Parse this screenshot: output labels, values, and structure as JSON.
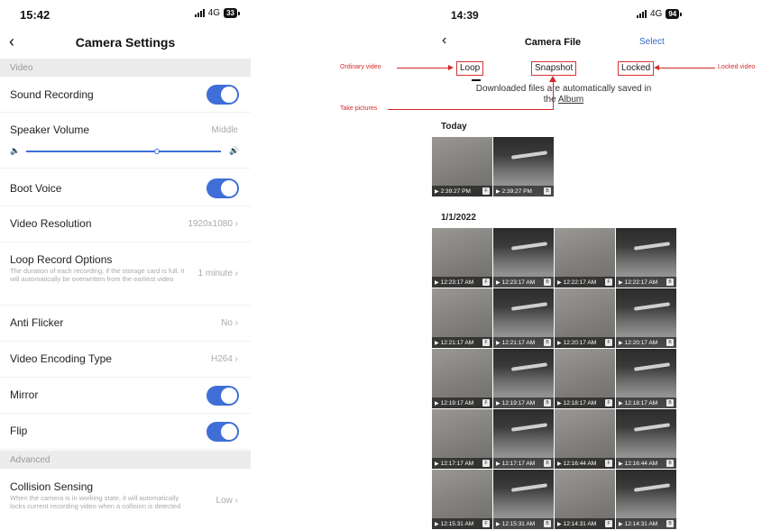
{
  "settings": {
    "status": {
      "time": "15:42",
      "network": "4G",
      "battery": "33"
    },
    "title": "Camera Settings",
    "sections": {
      "video": "Video",
      "advanced": "Advanced"
    },
    "sound_recording": {
      "label": "Sound Recording",
      "on": true
    },
    "speaker_volume": {
      "label": "Speaker Volume",
      "value": "Middle",
      "level_percent": 67
    },
    "boot_voice": {
      "label": "Boot Voice",
      "on": true
    },
    "video_resolution": {
      "label": "Video Resolution",
      "value": "1920x1080 ›"
    },
    "loop_record": {
      "label": "Loop Record Options",
      "desc": "The duration of each recording, if the storage card is full, it will automatically be overwritten from the earliest video",
      "value": "1 minute ›"
    },
    "anti_flicker": {
      "label": "Anti Flicker",
      "value": "No ›"
    },
    "encoding": {
      "label": "Video Encoding Type",
      "value": "H264 ›"
    },
    "mirror": {
      "label": "Mirror",
      "on": true
    },
    "flip": {
      "label": "Flip",
      "on": true
    },
    "collision": {
      "label": "Collision Sensing",
      "desc": "When the camera is in working state, it will automatically locks current recording video when a collision is detected",
      "value": "Low ›"
    }
  },
  "files": {
    "status": {
      "time": "14:39",
      "network": "4G",
      "battery": "94"
    },
    "title": "Camera File",
    "select_label": "Select",
    "tabs": {
      "loop": "Loop",
      "snapshot": "Snapshot",
      "locked": "Locked"
    },
    "notice_line1": "Downloaded files are automatically saved in",
    "notice_prefix": "the",
    "notice_album": "Album",
    "today_label": "Today",
    "date_label": "1/1/2022",
    "today_thumbs": [
      {
        "time": "2:39:27 PM",
        "badge": "F",
        "style": "gray"
      },
      {
        "time": "2:39:27 PM",
        "badge": "B",
        "style": "road"
      }
    ],
    "date_thumbs": [
      {
        "time": "12:23:17 AM",
        "badge": "F",
        "style": "gray"
      },
      {
        "time": "12:23:17 AM",
        "badge": "B",
        "style": "road"
      },
      {
        "time": "12:22:17 AM",
        "badge": "F",
        "style": "gray"
      },
      {
        "time": "12:22:17 AM",
        "badge": "B",
        "style": "road"
      },
      {
        "time": "12:21:17 AM",
        "badge": "F",
        "style": "gray"
      },
      {
        "time": "12:21:17 AM",
        "badge": "B",
        "style": "road"
      },
      {
        "time": "12:20:17 AM",
        "badge": "F",
        "style": "gray"
      },
      {
        "time": "12:20:17 AM",
        "badge": "B",
        "style": "road"
      },
      {
        "time": "12:19:17 AM",
        "badge": "F",
        "style": "gray"
      },
      {
        "time": "12:19:17 AM",
        "badge": "B",
        "style": "road"
      },
      {
        "time": "12:18:17 AM",
        "badge": "F",
        "style": "gray"
      },
      {
        "time": "12:18:17 AM",
        "badge": "B",
        "style": "road"
      },
      {
        "time": "12:17:17 AM",
        "badge": "F",
        "style": "gray"
      },
      {
        "time": "12:17:17 AM",
        "badge": "B",
        "style": "road"
      },
      {
        "time": "12:16:44 AM",
        "badge": "F",
        "style": "gray"
      },
      {
        "time": "12:16:44 AM",
        "badge": "B",
        "style": "road"
      },
      {
        "time": "12:15:31 AM",
        "badge": "F",
        "style": "gray"
      },
      {
        "time": "12:15:31 AM",
        "badge": "B",
        "style": "road"
      },
      {
        "time": "12:14:31 AM",
        "badge": "F",
        "style": "gray"
      },
      {
        "time": "12:14:31 AM",
        "badge": "B",
        "style": "road"
      }
    ]
  },
  "annotations": {
    "ordinary_video": "Ordinary video",
    "take_pictures": "Take pictures",
    "locked_video": "Locked video"
  },
  "colors": {
    "accent": "#3f6fd6",
    "annotation": "#d42a2a",
    "link": "#3568c9"
  }
}
